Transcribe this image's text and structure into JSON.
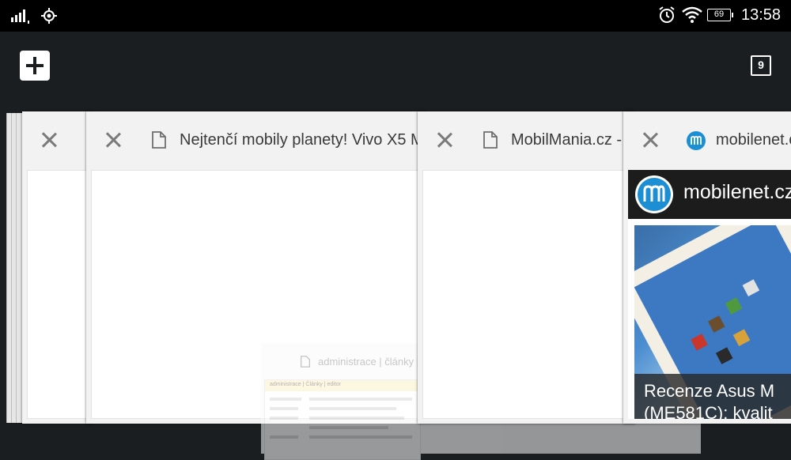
{
  "status_bar": {
    "battery": "69",
    "time": "13:58",
    "icons": [
      "signal-icon",
      "location-icon",
      "alarm-icon",
      "wifi-icon",
      "battery-icon"
    ]
  },
  "toolbar": {
    "tab_count": "9",
    "new_tab_icon": "plus-icon"
  },
  "tabs": [
    {
      "title": ""
    },
    {
      "title": "Nejtenčí mobily planety! Vivo X5 M"
    },
    {
      "title": "MobilMania.cz -"
    },
    {
      "title": "mobilenet.cz"
    }
  ],
  "ghost_tab": {
    "title": "administrace | články | e",
    "page_header": "administrace | Články | editor"
  },
  "mobilenet_page": {
    "site_name": "mobilenet.cz",
    "article_title_line1": "Recenze Asus M",
    "article_title_line2": "(ME581C): kvalit"
  },
  "colors": {
    "background": "#1b1e20",
    "status_bar": "#000000",
    "card_header": "#f2f2f2",
    "mobilenet_logo": "#1c8ed4"
  }
}
